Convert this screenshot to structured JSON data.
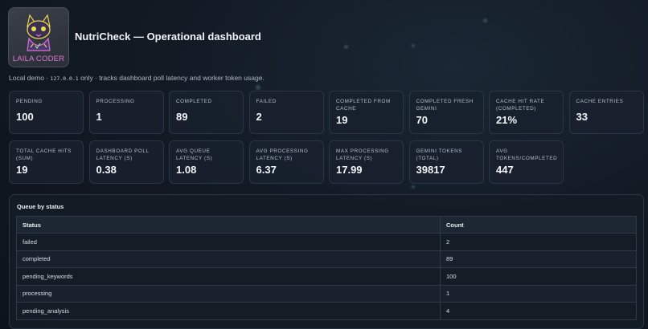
{
  "header": {
    "logo_text": "LAILA CODER",
    "title": "NutriCheck — Operational dashboard"
  },
  "subtitle": {
    "prefix": "Local demo · ",
    "code": "127.0.0.1",
    "suffix": " only · tracks dashboard poll latency and worker token usage."
  },
  "metrics": [
    {
      "label": "PENDING",
      "value": "100"
    },
    {
      "label": "PROCESSING",
      "value": "1"
    },
    {
      "label": "COMPLETED",
      "value": "89"
    },
    {
      "label": "FAILED",
      "value": "2"
    },
    {
      "label": "COMPLETED FROM CACHE",
      "value": "19"
    },
    {
      "label": "COMPLETED FRESH GEMINI",
      "value": "70"
    },
    {
      "label": "CACHE HIT RATE (COMPLETED)",
      "value": "21%"
    },
    {
      "label": "CACHE ENTRIES",
      "value": "33"
    },
    {
      "label": "TOTAL CACHE HITS (SUM)",
      "value": "19"
    },
    {
      "label": "DASHBOARD POLL LATENCY (S)",
      "value": "0.38"
    },
    {
      "label": "AVG QUEUE LATENCY (S)",
      "value": "1.08"
    },
    {
      "label": "AVG PROCESSING LATENCY (S)",
      "value": "6.37"
    },
    {
      "label": "MAX PROCESSING LATENCY (S)",
      "value": "17.99"
    },
    {
      "label": "GEMINI TOKENS (TOTAL)",
      "value": "39817"
    },
    {
      "label": "AVG TOKENS/COMPLETED",
      "value": "447"
    }
  ],
  "queue": {
    "title": "Queue by status",
    "headers": {
      "status": "Status",
      "count": "Count"
    },
    "rows": [
      {
        "status": "failed",
        "count": "2"
      },
      {
        "status": "completed",
        "count": "89"
      },
      {
        "status": "pending_keywords",
        "count": "100"
      },
      {
        "status": "processing",
        "count": "1"
      },
      {
        "status": "pending_analysis",
        "count": "4"
      }
    ]
  }
}
